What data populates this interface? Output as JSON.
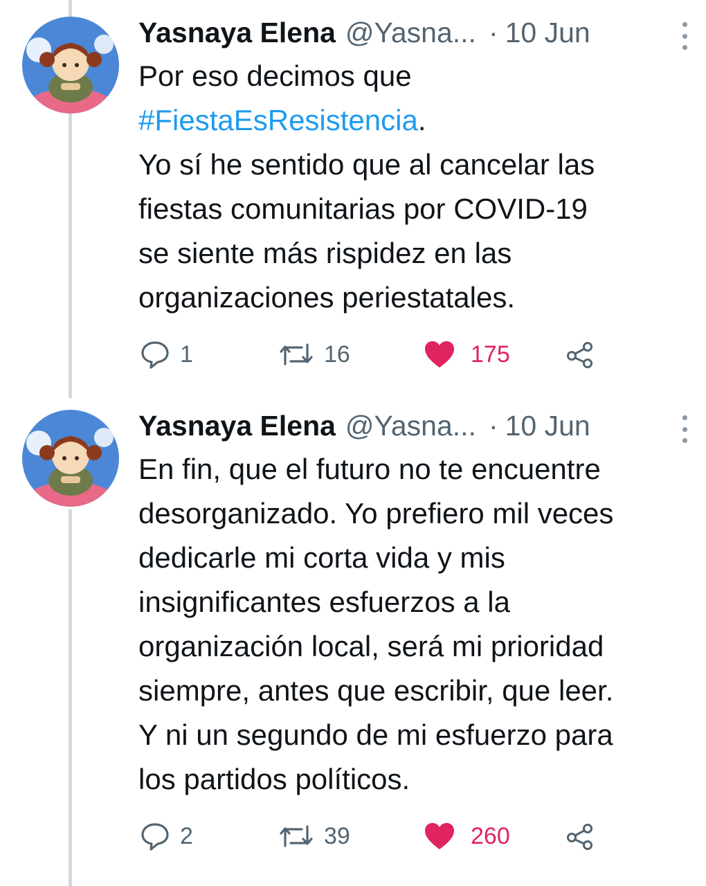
{
  "tweets": [
    {
      "author_name": "Yasnaya Elena",
      "handle": "@Yasna...",
      "separator": "·",
      "date": "10 Jun",
      "hashtag": "#FiestaEsResistencia",
      "lines": [
        "Por eso decimos que",
        ".",
        "Yo sí he sentido que al cancelar las",
        "fiestas comunitarias por COVID-19",
        "se siente más rispidez en las",
        "organizaciones periestatales."
      ],
      "replies": "1",
      "retweets": "16",
      "likes": "175"
    },
    {
      "author_name": "Yasnaya Elena",
      "handle": "@Yasna...",
      "separator": "·",
      "date": "10 Jun",
      "lines": [
        "En fin, que el futuro no te encuentre",
        "desorganizado. Yo prefiero mil veces",
        "dedicarle mi corta vida y mis",
        "insignificantes esfuerzos a la",
        "organización local, será mi prioridad",
        "siempre, antes que escribir, que leer.",
        "Y ni un segundo de mi esfuerzo para",
        "los partidos políticos."
      ],
      "replies": "2",
      "retweets": "39",
      "likes": "260"
    }
  ],
  "icons": {
    "reply": "reply-icon",
    "retweet": "retweet-icon",
    "like": "heart-icon",
    "share": "share-icon",
    "more": "more-options-icon"
  },
  "colors": {
    "text": "#0f1419",
    "secondary": "#536471",
    "link": "#1d9bf0",
    "like": "#e0245e",
    "thread_line": "#cfd9de"
  }
}
